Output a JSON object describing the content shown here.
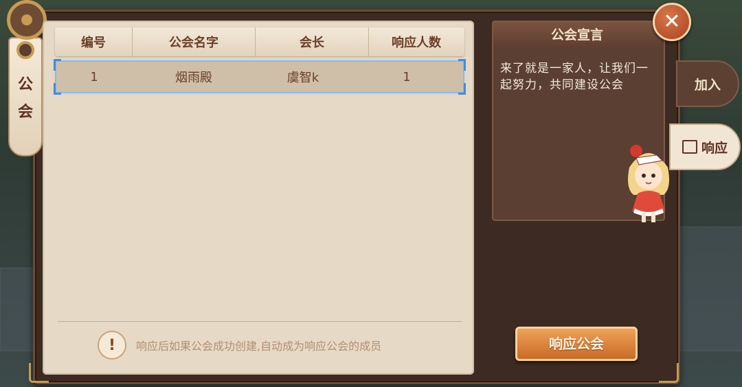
{
  "window": {
    "side_tab_label_1": "公",
    "side_tab_label_2": "会",
    "close_icon": "✕"
  },
  "table": {
    "headers": [
      "编号",
      "公会名字",
      "会长",
      "响应人数"
    ],
    "rows": [
      {
        "id": "1",
        "name": "烟雨殿",
        "leader": "虞智k",
        "count": "1"
      }
    ]
  },
  "notice": {
    "icon": "!",
    "text": "响应后如果公会成功创建,自动成为响应公会的成员"
  },
  "declaration": {
    "title": "公会宣言",
    "text": "来了就是一家人，让我们一起努力，共同建设公会"
  },
  "buttons": {
    "respond_guild": "响应公会"
  },
  "tabs": {
    "join": "加入",
    "respond": "响应"
  }
}
